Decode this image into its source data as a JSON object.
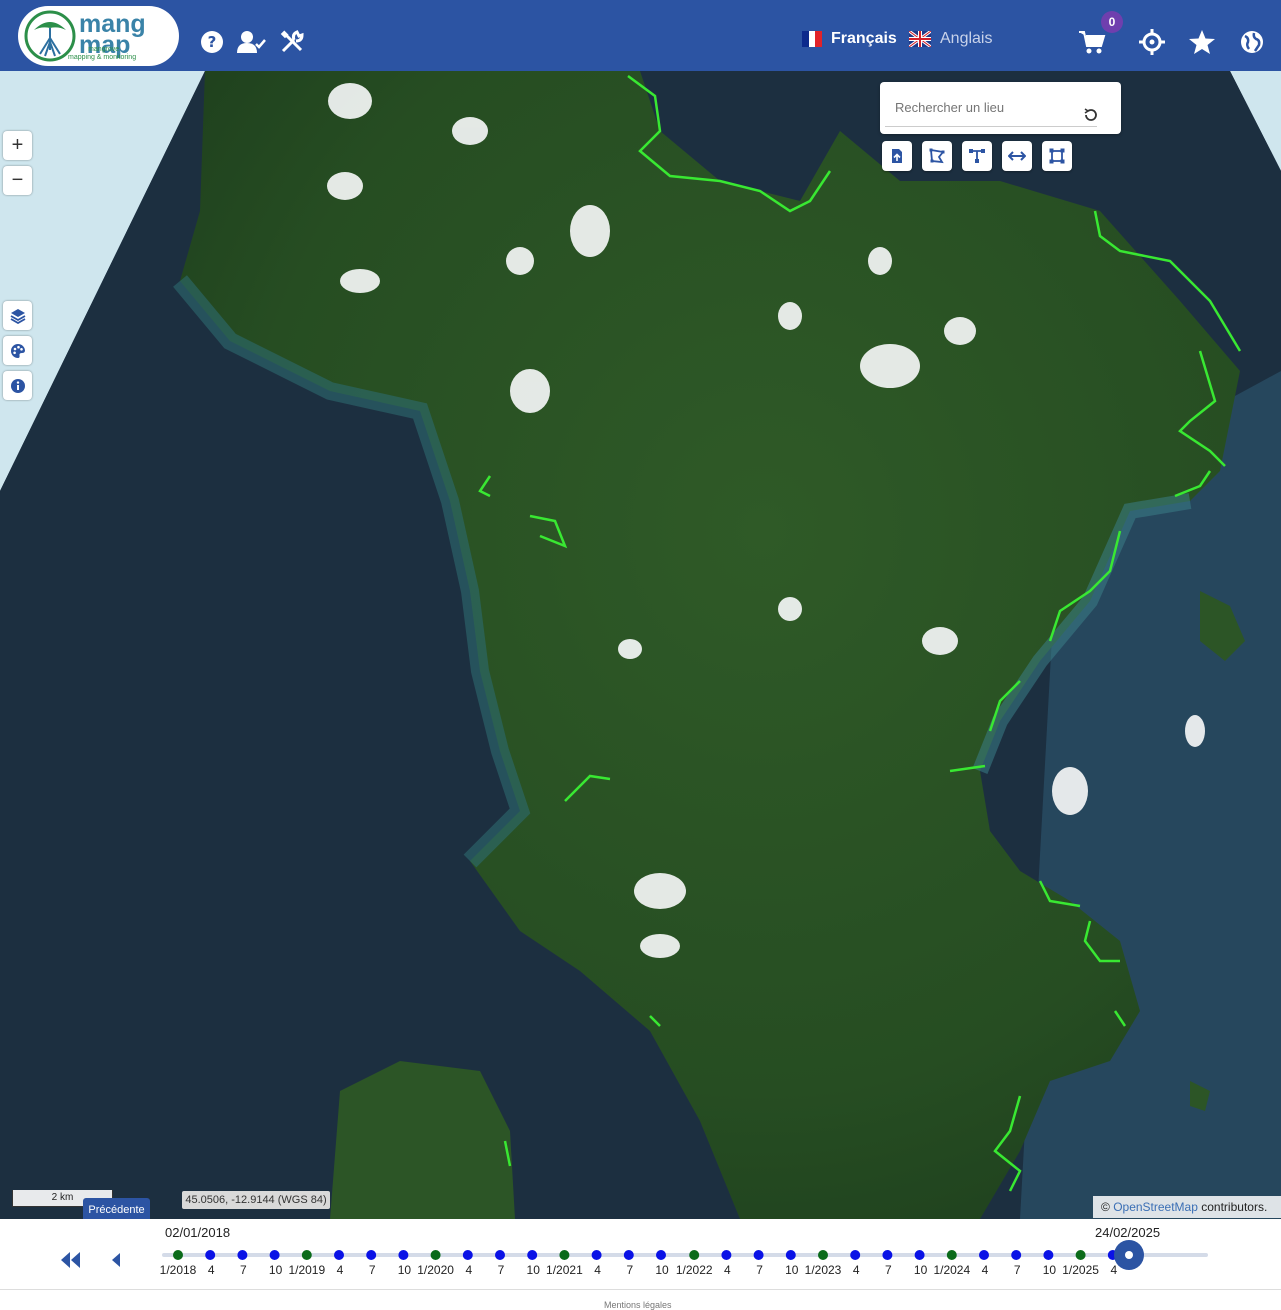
{
  "header": {
    "logo_line1": "mang",
    "logo_line2": "map",
    "logo_sub1": "mangrove",
    "logo_sub2": "mapping & monitoring",
    "lang_fr": "Français",
    "lang_en": "Anglais",
    "cart_count": "0",
    "icons": [
      "help-icon",
      "user-check-icon",
      "tools-icon",
      "cart-icon",
      "crosshair-icon",
      "star-icon",
      "globe-icon"
    ]
  },
  "map": {
    "zoom_in": "+",
    "zoom_out": "−",
    "search_placeholder": "Rechercher un lieu",
    "scale_label": "2 km",
    "coordinates": "45.0506, -12.9144 (WGS 84)",
    "attribution_prefix": "©",
    "attribution_link": "OpenStreetMap",
    "attribution_suffix": "contributors.",
    "prev_tooltip": "Précédente",
    "tool_icons": [
      "upload-shape-icon",
      "draw-polygon-icon",
      "draw-line-icon",
      "measure-icon",
      "bbox-icon"
    ],
    "side_icons": [
      "layers-icon",
      "palette-icon",
      "info-icon"
    ]
  },
  "timeline": {
    "start_date": "02/01/2018",
    "end_date": "24/02/2025",
    "ticks": [
      "1/2018",
      "4",
      "7",
      "10",
      "1/2019",
      "4",
      "7",
      "10",
      "1/2020",
      "4",
      "7",
      "10",
      "1/2021",
      "4",
      "7",
      "10",
      "1/2022",
      "4",
      "7",
      "10",
      "1/2023",
      "4",
      "7",
      "10",
      "1/2024",
      "4",
      "7",
      "10",
      "1/2025",
      "4"
    ],
    "current_position": 0.967,
    "colors": {
      "year_dot": "#0b6b1a",
      "quarter_dot": "#0a12e6",
      "cursor": "#2c54a3"
    }
  },
  "footer": {
    "legal": "Mentions légales"
  }
}
